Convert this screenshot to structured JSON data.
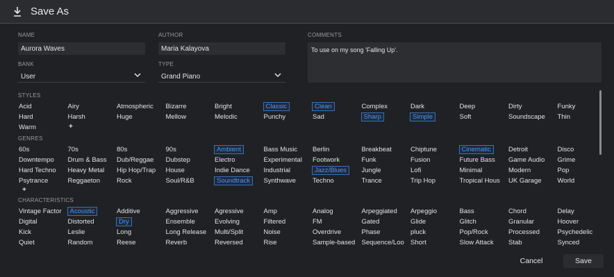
{
  "window": {
    "title": "Save As",
    "icon": "download-icon"
  },
  "fields": {
    "name": {
      "label": "NAME",
      "value": "Aurora Waves"
    },
    "author": {
      "label": "AUTHOR",
      "value": "Maria Kalayova"
    },
    "comments": {
      "label": "COMMENTS",
      "value": "To use on my song 'Falling Up'."
    },
    "bank": {
      "label": "BANK",
      "value": "User"
    },
    "type": {
      "label": "TYPE",
      "value": "Grand Piano"
    }
  },
  "styles": {
    "label": "STYLES",
    "rows": [
      [
        "Acid",
        "Airy",
        "Atmospheric",
        "Bizarre",
        "Bright",
        "Classic",
        "Clean",
        "Complex",
        "Dark",
        "Deep",
        "Dirty",
        "Funky"
      ],
      [
        "Hard",
        "Harsh",
        "Huge",
        "Mellow",
        "Melodic",
        "Punchy",
        "Sad",
        "Sharp",
        "Simple",
        "Soft",
        "Soundscape",
        "Thin"
      ],
      [
        "Warm"
      ]
    ],
    "selected": [
      "Classic",
      "Clean",
      "Sharp",
      "Simple"
    ],
    "add": "+"
  },
  "genres": {
    "label": "GENRES",
    "rows": [
      [
        "60s",
        "70s",
        "80s",
        "90s",
        "Ambient",
        "Bass Music",
        "Berlin",
        "Breakbeat",
        "Chiptune",
        "Cinematic",
        "Detroit",
        "Disco"
      ],
      [
        "Downtempo",
        "Drum & Bass",
        "Dub/Reggae",
        "Dubstep",
        "Electro",
        "Experimental",
        "Footwork",
        "Funk",
        "Fusion",
        "Future Bass",
        "Game Audio",
        "Grime"
      ],
      [
        "Hard Techno",
        "Heavy Metal",
        "Hip Hop/Trap",
        "House",
        "Indie Dance",
        "Industrial",
        "Jazz/Blues",
        "Jungle",
        "Lofi",
        "Minimal",
        "Modern",
        "Pop"
      ],
      [
        "Psytrance",
        "Reggaeton",
        "Rock",
        "Soul/R&B",
        "Soundtrack",
        "Synthwave",
        "Techno",
        "Trance",
        "Trip Hop",
        "Tropical Hous",
        "UK Garage",
        "World"
      ]
    ],
    "selected": [
      "Ambient",
      "Cinematic",
      "Jazz/Blues",
      "Soundtrack"
    ],
    "add": "+"
  },
  "characteristics": {
    "label": "CHARACTERISTICS",
    "rows": [
      [
        "Vintage Factor",
        "Acoustic",
        "Additive",
        "Aggressive",
        "Agressive",
        "Amp",
        "Analog",
        "Arpeggiated",
        "Arpeggio",
        "Bass",
        "Chord",
        "Delay"
      ],
      [
        "Digital",
        "Distorted",
        "Dry",
        "Ensemble",
        "Evolving",
        "Filtered",
        "FM",
        "Gated",
        "Glide",
        "Glitch",
        "Granular",
        "Hoover"
      ],
      [
        "Kick",
        "Leslie",
        "Long",
        "Long Release",
        "Multi/Split",
        "Noise",
        "Overdrive",
        "Phase",
        "pluck",
        "Pop/Rock",
        "Processed",
        "Psychedelic"
      ],
      [
        "Quiet",
        "Random",
        "Reese",
        "Reverb",
        "Reversed",
        "Rise",
        "Sample-based",
        "Sequence/Loo",
        "Short",
        "Slow Attack",
        "Stab",
        "Synced"
      ]
    ],
    "selected": [
      "Acoustic",
      "Dry"
    ]
  },
  "buttons": {
    "cancel": "Cancel",
    "save": "Save"
  },
  "colors": {
    "selected_tag": "#4d93f0",
    "background": "#1f2124"
  }
}
